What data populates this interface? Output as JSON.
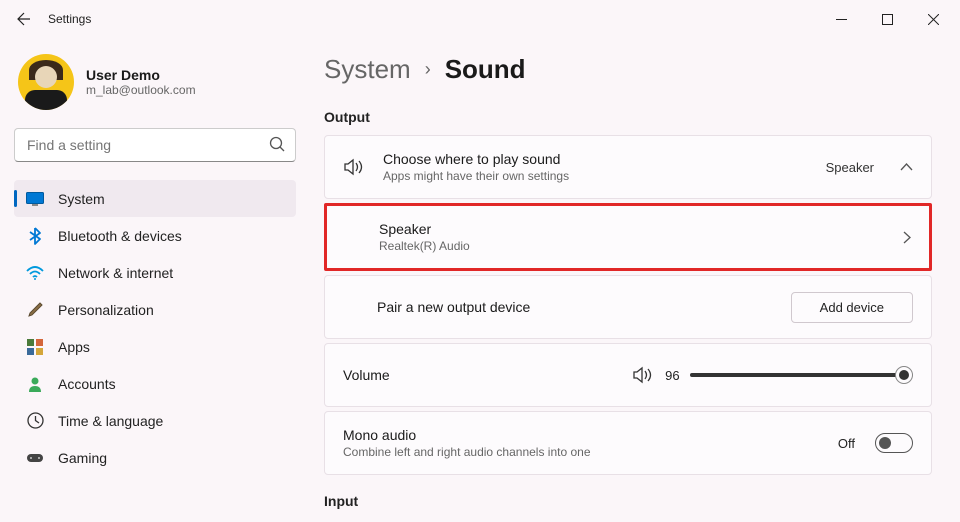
{
  "titlebar": {
    "title": "Settings"
  },
  "user": {
    "name": "User Demo",
    "email": "m_lab@outlook.com"
  },
  "search": {
    "placeholder": "Find a setting"
  },
  "nav": {
    "items": [
      {
        "label": "System",
        "icon": "system",
        "active": true
      },
      {
        "label": "Bluetooth & devices",
        "icon": "bluetooth"
      },
      {
        "label": "Network & internet",
        "icon": "network"
      },
      {
        "label": "Personalization",
        "icon": "personalization"
      },
      {
        "label": "Apps",
        "icon": "apps"
      },
      {
        "label": "Accounts",
        "icon": "accounts"
      },
      {
        "label": "Time & language",
        "icon": "time"
      },
      {
        "label": "Gaming",
        "icon": "gaming"
      }
    ]
  },
  "breadcrumb": {
    "parent": "System",
    "current": "Sound"
  },
  "sections": {
    "output": "Output",
    "input": "Input"
  },
  "output": {
    "choose": {
      "title": "Choose where to play sound",
      "sub": "Apps might have their own settings",
      "value": "Speaker"
    },
    "speaker": {
      "title": "Speaker",
      "sub": "Realtek(R) Audio"
    },
    "pair": {
      "title": "Pair a new output device",
      "button": "Add device"
    },
    "volume": {
      "title": "Volume",
      "value": "96"
    },
    "mono": {
      "title": "Mono audio",
      "sub": "Combine left and right audio channels into one",
      "state": "Off"
    }
  }
}
